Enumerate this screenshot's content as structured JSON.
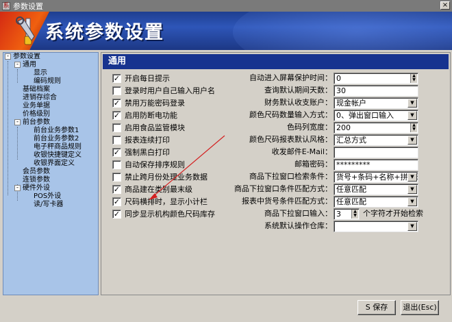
{
  "window": {
    "title": "参数设置",
    "app_icon_glyph": "系",
    "close_glyph": "×"
  },
  "banner": {
    "title": "系统参数设置"
  },
  "tree": {
    "items": [
      {
        "label": "参数设置",
        "toggle": "-"
      },
      {
        "label": "通用",
        "toggle": "-"
      },
      {
        "label": "显示"
      },
      {
        "label": "编码规则"
      },
      {
        "label": "基础档案"
      },
      {
        "label": "进销存综合"
      },
      {
        "label": "业务单据"
      },
      {
        "label": "价格级别"
      },
      {
        "label": "前台参数",
        "toggle": "-"
      },
      {
        "label": "前台业务参数1"
      },
      {
        "label": "前台业务参数2"
      },
      {
        "label": "电子秤商品规则"
      },
      {
        "label": "收银快捷键定义"
      },
      {
        "label": "收银界面定义"
      },
      {
        "label": "会员参数"
      },
      {
        "label": "连锁参数"
      },
      {
        "label": "硬件外设",
        "toggle": "-"
      },
      {
        "label": "POS外设"
      },
      {
        "label": "读/写卡器"
      }
    ]
  },
  "panel": {
    "title": "通用",
    "checkboxes": [
      {
        "label": "开启每日提示",
        "checked": true
      },
      {
        "label": "登录时用户自己输入用户名",
        "checked": false
      },
      {
        "label": "禁用万能密码登录",
        "checked": true
      },
      {
        "label": "启用防断电功能",
        "checked": true
      },
      {
        "label": "启用食品监管模块",
        "checked": false
      },
      {
        "label": "报表连续打印",
        "checked": false
      },
      {
        "label": "强制黑白打印",
        "checked": true
      },
      {
        "label": "自动保存排序规则",
        "checked": false
      },
      {
        "label": "禁止跨月份处理业务数据",
        "checked": false
      },
      {
        "label": "商品建在类别最末级",
        "checked": true
      },
      {
        "label": "尺码横排时，显示小计栏",
        "checked": true
      },
      {
        "label": "同步显示机构颜色尺码库存",
        "checked": true
      }
    ],
    "fields": [
      {
        "label": "自动进入屏幕保护时间：",
        "value": "0",
        "kind": "spin"
      },
      {
        "label": "查询默认期间天数：",
        "value": "30",
        "kind": "text"
      },
      {
        "label": "财务默认收支账户：",
        "value": "现金帐户",
        "kind": "combo"
      },
      {
        "label": "颜色尺码数量输入方式：",
        "value": "0、弹出窗口输入",
        "kind": "combo"
      },
      {
        "label": "色码列宽度：",
        "value": "200",
        "kind": "spin"
      },
      {
        "label": "颜色尺码报表默认风格：",
        "value": "汇总方式",
        "kind": "combo"
      },
      {
        "label": "收发邮件E-Mail：",
        "value": "",
        "kind": "text"
      },
      {
        "label": "邮箱密码：",
        "value": "*********",
        "kind": "text"
      },
      {
        "label": "商品下拉窗口检索条件：",
        "value": "货号+条码+名称+拼音码",
        "kind": "combo"
      },
      {
        "label": "商品下拉窗口条件匹配方式：",
        "value": "任意匹配",
        "kind": "combo"
      },
      {
        "label": "报表中货号条件匹配方式：",
        "value": "任意匹配",
        "kind": "combo"
      },
      {
        "label": "商品下拉窗口输入：",
        "value": "3",
        "kind": "spin-short"
      },
      {
        "label": "系统默认操作仓库：",
        "value": "",
        "kind": "combo"
      }
    ],
    "dropdown_suffix": "个字符才开始检索"
  },
  "buttons": {
    "save": "S 保存",
    "exit": "退出(Esc)"
  },
  "colors": {
    "header": "#17338f",
    "tree_bg": "#a8c4e8",
    "annotation_arrow": "#d32020"
  }
}
